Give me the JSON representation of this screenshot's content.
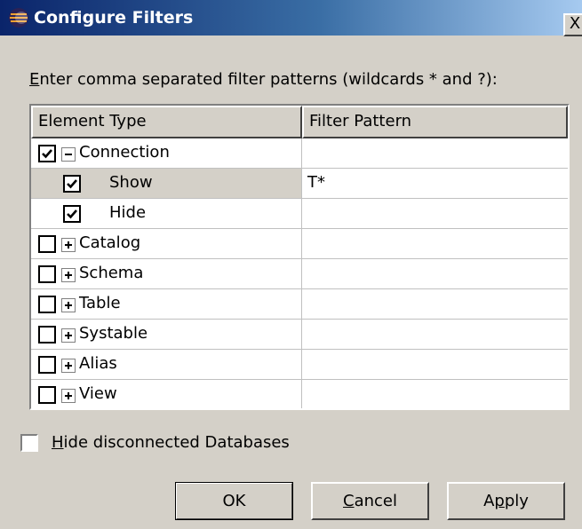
{
  "window": {
    "title": "Configure Filters",
    "close_glyph": "X"
  },
  "instruction": {
    "mnemonic": "E",
    "rest": "nter comma separated filter patterns (wildcards * and ?):"
  },
  "table": {
    "columns": [
      "Element Type",
      "Filter Pattern"
    ],
    "rows": [
      {
        "label": "Connection",
        "checked": true,
        "expander": "minus",
        "pattern": ""
      },
      {
        "label": "Show",
        "checked": true,
        "expander": null,
        "pattern": "T*",
        "selected": true
      },
      {
        "label": "Hide",
        "checked": true,
        "expander": null,
        "pattern": ""
      },
      {
        "label": "Catalog",
        "checked": false,
        "expander": "plus",
        "pattern": ""
      },
      {
        "label": "Schema",
        "checked": false,
        "expander": "plus",
        "pattern": ""
      },
      {
        "label": "Table",
        "checked": false,
        "expander": "plus",
        "pattern": ""
      },
      {
        "label": "Systable",
        "checked": false,
        "expander": "plus",
        "pattern": ""
      },
      {
        "label": "Alias",
        "checked": false,
        "expander": "plus",
        "pattern": ""
      },
      {
        "label": "View",
        "checked": false,
        "expander": "plus",
        "pattern": ""
      }
    ]
  },
  "hide_disconnected": {
    "mnemonic": "H",
    "rest": "ide disconnected Databases",
    "checked": false
  },
  "buttons": {
    "ok": "OK",
    "cancel_mnemonic": "C",
    "cancel_rest": "ancel",
    "apply_a": "A",
    "apply_mnemonic": "p",
    "apply_rest": "ply"
  },
  "colors": {
    "dialog_bg": "#d4d0c8",
    "title_start": "#0a246a",
    "title_end": "#a6caf0"
  },
  "icons": {
    "app": "eclipse-icon",
    "close": "close-icon",
    "check": "checkmark-icon",
    "expand": "plus-expander-icon",
    "collapse": "minus-expander-icon"
  }
}
